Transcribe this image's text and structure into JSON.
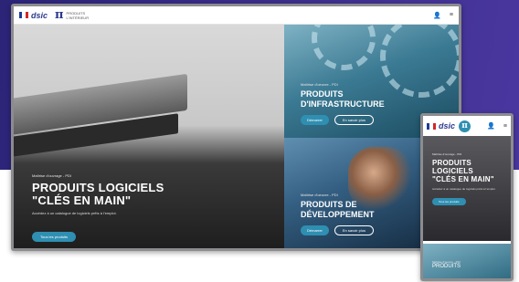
{
  "colors": {
    "purple": "#3b2e8a",
    "accent_button": "#2f8fb2",
    "flag_blue": "#1d3b9a",
    "flag_white": "#ffffff",
    "flag_red": "#d42727"
  },
  "header": {
    "logo_text": "dsic",
    "pi_symbol": "π",
    "brand_line": "PRODUITS L'INTÉRIEUR",
    "user_icon": "user-icon",
    "menu_icon": "menu-icon"
  },
  "hero": {
    "kicker": "Maîtrise d'ouvrage - PDI",
    "title_line1": "PRODUITS LOGICIELS",
    "title_line2": "\"CLÉS EN MAIN\"",
    "description": "Accédez à un catalogue de logiciels prêts à l'emploi.",
    "button": "Tous les produits"
  },
  "tiles": [
    {
      "kicker": "Maîtrise d'oeuvre - PDI",
      "title_line1": "PRODUITS",
      "title_line2": "D'INFRASTRUCTURE",
      "primary": "Démarrer",
      "secondary": "En savoir plus"
    },
    {
      "kicker": "Maîtrise d'oeuvre - PDI",
      "title_line1": "PRODUITS DE",
      "title_line2": "DÉVELOPPEMENT",
      "primary": "Démarrer",
      "secondary": "En savoir plus"
    }
  ],
  "mobile": {
    "logo_text": "dsic",
    "pi_symbol": "π",
    "kicker": "Maîtrise d'ouvrage - PDI",
    "title_line1": "PRODUITS",
    "title_line2": "LOGICIELS",
    "title_line3": "\"CLÉS EN MAIN\"",
    "description": "Accédez à un catalogue de logiciels prêts à l'emploi.",
    "button": "Tous les produits",
    "tile_kicker": "Maîtrise d'oeuvre - PDI",
    "tile_title": "PRODUITS"
  }
}
